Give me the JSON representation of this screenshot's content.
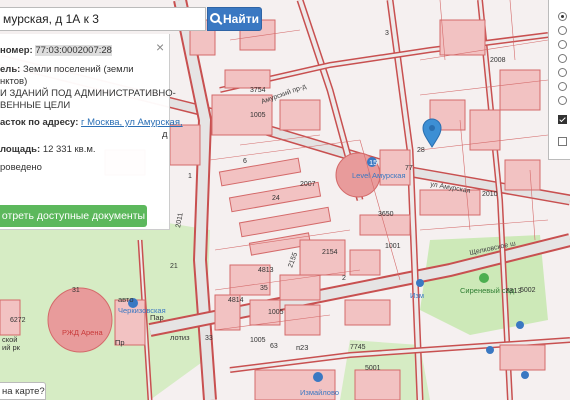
{
  "search": {
    "value": "мурская, д 1А к 3",
    "button_label": "Найти"
  },
  "info_panel": {
    "line1_label": "номер:",
    "cadastral_number": "77:03:0002007:28",
    "line2_label": "ель:",
    "line2_value": "Земли поселений (земли",
    "line3": "нктов)",
    "line4": "И ЗДАНИЙ ПОД АДМИНИСТРАТИВНО-",
    "line5": "ВЕННЫЕ ЦЕЛИ",
    "address_label": "асток по адресу:",
    "address_link": "г Москва, ул Амурская,",
    "address_cont": "д",
    "area_label": "лощадь:",
    "area_value": "12 331 кв.м.",
    "status": "роведено",
    "docs_button": "отреть доступные документы"
  },
  "feedback_label": "на карте?",
  "map": {
    "block_labels": [
      "3754",
      "1005",
      "2007",
      "24",
      "2008",
      "3",
      "2010",
      "1001",
      "3650",
      "2154",
      "4813",
      "2155",
      "4814",
      "2",
      "1005",
      "1005",
      "7745",
      "5001",
      "5002",
      "6272",
      "31",
      "2011",
      "1",
      "21",
      "28",
      "77",
      "6",
      "63",
      "33",
      "35"
    ],
    "streets": [
      "Амурский пр-д",
      "ул Амурская",
      "Щелковское ш"
    ],
    "poi": [
      "Level Амурская",
      "РЖД Арена",
      "Черкизовская",
      "Сиреневый сад",
      "Измайлово",
      "Изм",
      "авто",
      "Пр",
      "Пар",
      "ий рк",
      "ской",
      "п23",
      "лотиз"
    ],
    "poi_numbers": [
      "15",
      "7813"
    ]
  },
  "layers_panel": {
    "radio_count": 7,
    "checkbox_count": 2,
    "checkbox_states": [
      true,
      false
    ]
  },
  "colors": {
    "parcel": "#f2c2c2",
    "parcel_stroke": "#d46a6a",
    "road": "#e0e0e0",
    "road_edge": "#c85050",
    "park": "#cde9b8",
    "marker": "#3d8fd4",
    "accent": "#3a78c2",
    "docs_button": "#5cb85c"
  }
}
